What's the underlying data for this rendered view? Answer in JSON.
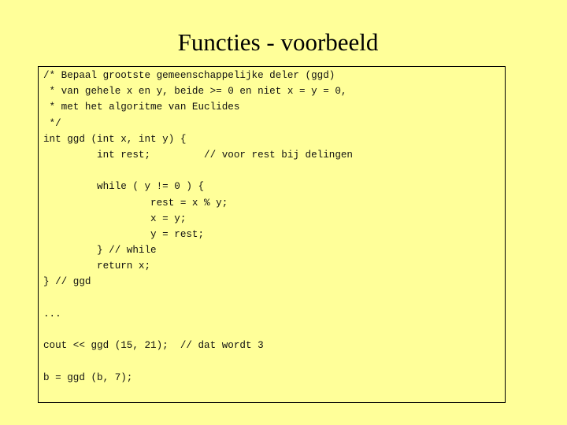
{
  "slide": {
    "title": "Functies - voorbeeld"
  },
  "code": {
    "lines": [
      "/* Bepaal grootste gemeenschappelijke deler (ggd)",
      " * van gehele x en y, beide >= 0 en niet x = y = 0,",
      " * met het algoritme van Euclides",
      " */",
      "int ggd (int x, int y) {",
      "         int rest;         // voor rest bij delingen",
      "",
      "         while ( y != 0 ) {",
      "                  rest = x % y;",
      "                  x = y;",
      "                  y = rest;",
      "         } // while",
      "         return x;",
      "} // ggd",
      "",
      "...",
      "",
      "cout << ggd (15, 21);  // dat wordt 3",
      "",
      "b = ggd (b, 7);"
    ]
  },
  "colors": {
    "background": "#ffff99",
    "text": "#000000",
    "border": "#000000"
  }
}
